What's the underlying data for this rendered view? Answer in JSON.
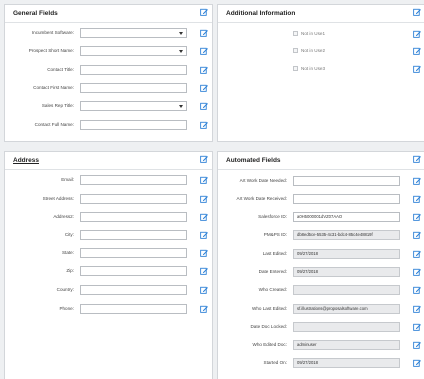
{
  "colors": {
    "accent": "#2b7fd6"
  },
  "icons": {
    "edit": "edit-pencil-icon"
  },
  "general": {
    "title": "General Fields",
    "fields": [
      {
        "label": "Incumbent Software:",
        "value": "",
        "type": "select"
      },
      {
        "label": "Prospect Short Name:",
        "value": "",
        "type": "select"
      },
      {
        "label": "Contact Title:",
        "value": "",
        "type": "text"
      },
      {
        "label": "Contact First Name:",
        "value": "",
        "type": "text"
      },
      {
        "label": "Sales Rep Title:",
        "value": "",
        "type": "select"
      },
      {
        "label": "Contact Full Name:",
        "value": "",
        "type": "text"
      }
    ]
  },
  "additional": {
    "title": "Additional Information",
    "checkboxes": [
      {
        "label": "Not in Use1",
        "checked": false
      },
      {
        "label": "Not in Use2",
        "checked": false
      },
      {
        "label": "Not in Use3",
        "checked": false
      }
    ]
  },
  "address": {
    "title": "Address",
    "fields": [
      {
        "label": "Email:",
        "value": ""
      },
      {
        "label": "Street Address:",
        "value": ""
      },
      {
        "label": "Address2:",
        "value": ""
      },
      {
        "label": "City:",
        "value": ""
      },
      {
        "label": "State:",
        "value": ""
      },
      {
        "label": "Zip:",
        "value": ""
      },
      {
        "label": "Country:",
        "value": ""
      },
      {
        "label": "Phone:",
        "value": ""
      }
    ]
  },
  "automated": {
    "title": "Automated Fields",
    "fields": [
      {
        "label": "Art Work Date Needed:",
        "value": "",
        "readonly": false
      },
      {
        "label": "Art Work Date Received:",
        "value": "",
        "readonly": false
      },
      {
        "label": "Salesforce ID:",
        "value": "a0H5000001dVZ07AAO",
        "readonly": false
      },
      {
        "label": "PM&PS ID:",
        "value": "db8ed5ce-5535-4c31-bdc4-85c4e48819f",
        "readonly": true
      },
      {
        "label": "Last Edited:",
        "value": "09/27/2018",
        "readonly": true
      },
      {
        "label": "Date Entered:",
        "value": "09/27/2018",
        "readonly": true
      },
      {
        "label": "Who Created:",
        "value": "",
        "readonly": true
      },
      {
        "label": "Who Last Edited:",
        "value": "sf.illustrations@proposalsoftware.com",
        "readonly": true
      },
      {
        "label": "Date Doc Locked:",
        "value": "",
        "readonly": true
      },
      {
        "label": "Who Edited Doc:",
        "value": "adminuser",
        "readonly": true
      },
      {
        "label": "Started On:",
        "value": "09/27/2018",
        "readonly": true
      }
    ]
  }
}
